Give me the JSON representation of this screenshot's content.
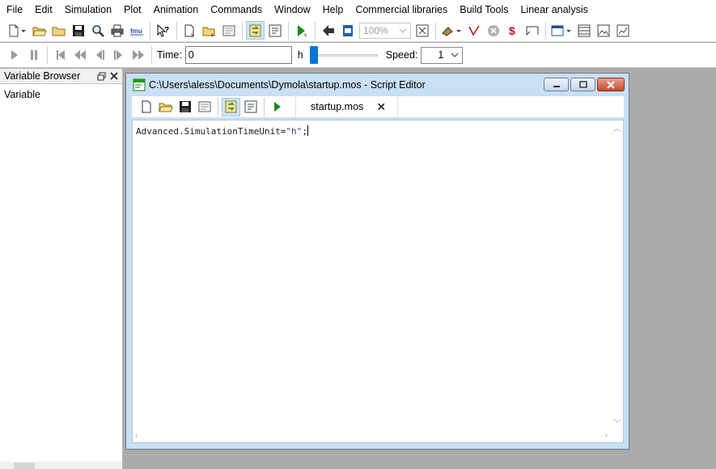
{
  "menu": [
    "File",
    "Edit",
    "Simulation",
    "Plot",
    "Animation",
    "Commands",
    "Window",
    "Help",
    "Commercial libraries",
    "Build Tools",
    "Linear analysis"
  ],
  "toolbar": {
    "zoom_value": "100%"
  },
  "animation_bar": {
    "time_label": "Time:",
    "time_value": "0",
    "time_unit": "h",
    "speed_label": "Speed:",
    "speed_value": "1"
  },
  "variable_browser": {
    "title": "Variable Browser",
    "column_header": "Variable"
  },
  "script_editor": {
    "title": "C:\\Users\\aless\\Documents\\Dymola\\startup.mos - Script Editor",
    "tab_label": "startup.mos",
    "code_prefix": "Advanced.SimulationTimeUnit=",
    "code_string": "\"h\"",
    "code_suffix": ";"
  },
  "colors": {
    "accent": "#0078d7",
    "window_frame": "#c9dff3",
    "workspace": "#ababab"
  }
}
